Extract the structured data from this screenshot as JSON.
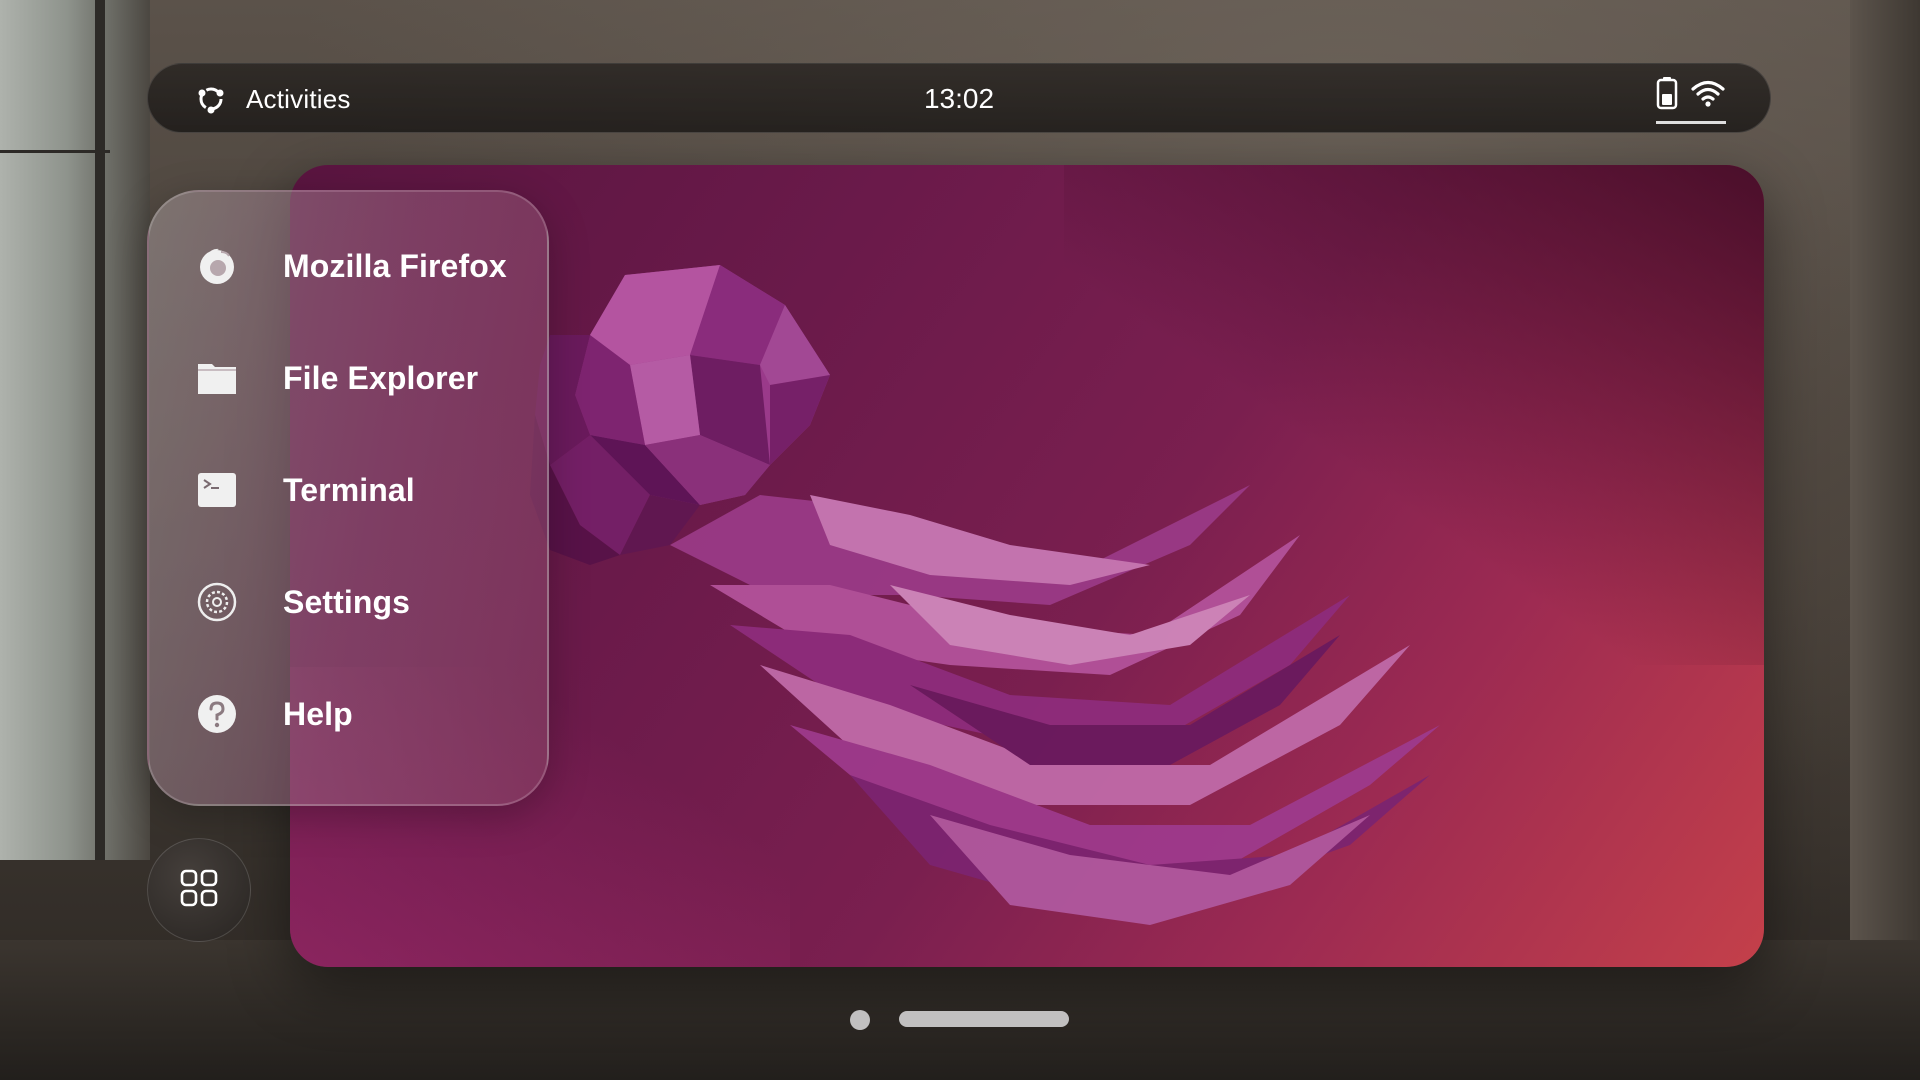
{
  "topbar": {
    "activities_label": "Activities",
    "activities_icon": "ubuntu-logo-icon",
    "clock": "13:02",
    "status_icons": [
      "battery-icon",
      "wifi-icon"
    ]
  },
  "app_menu": {
    "items": [
      {
        "label": "Mozilla Firefox",
        "icon": "firefox-icon"
      },
      {
        "label": "File Explorer",
        "icon": "folder-icon"
      },
      {
        "label": "Terminal",
        "icon": "terminal-icon"
      },
      {
        "label": "Settings",
        "icon": "gear-icon"
      },
      {
        "label": "Help",
        "icon": "help-icon"
      }
    ]
  },
  "dock": {
    "grid_button_icon": "app-grid-icon"
  },
  "pager": {
    "indicators": [
      "page-dot",
      "home-bar"
    ]
  },
  "colors": {
    "wallpaper_dark": "#5a1540",
    "wallpaper_mid": "#7a1f4f",
    "wallpaper_warm": "#c4404a",
    "jellyfish_base": "#8a2a78",
    "text": "#ffffff"
  }
}
